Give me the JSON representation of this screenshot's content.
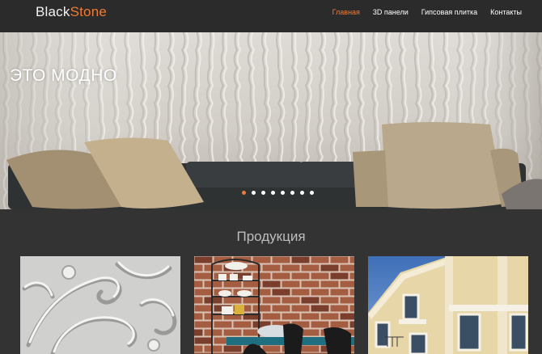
{
  "logo": {
    "part1": "Black",
    "part2": "Stone"
  },
  "nav": {
    "items": [
      {
        "label": "Главная",
        "active": true
      },
      {
        "label": "3D панели",
        "active": false
      },
      {
        "label": "Гипсовая плитка",
        "active": false
      },
      {
        "label": "Контакты",
        "active": false
      }
    ]
  },
  "hero": {
    "caption": "ЭТО МОДНО",
    "slides_count": 8,
    "active_slide": 1
  },
  "products": {
    "title": "Продукция",
    "cards": [
      {
        "name": "product-card-3d-panels",
        "image": "white ornamental 3D panel"
      },
      {
        "name": "product-card-brick-tile",
        "image": "brick wall interior with shelf"
      },
      {
        "name": "product-card-facade",
        "image": "building facade with decor"
      }
    ]
  },
  "colors": {
    "accent": "#f07b34",
    "header_bg": "#2b2b2b",
    "page_bg": "#333333",
    "nav_text": "#ffffff",
    "title_text": "#bdbdbd"
  }
}
